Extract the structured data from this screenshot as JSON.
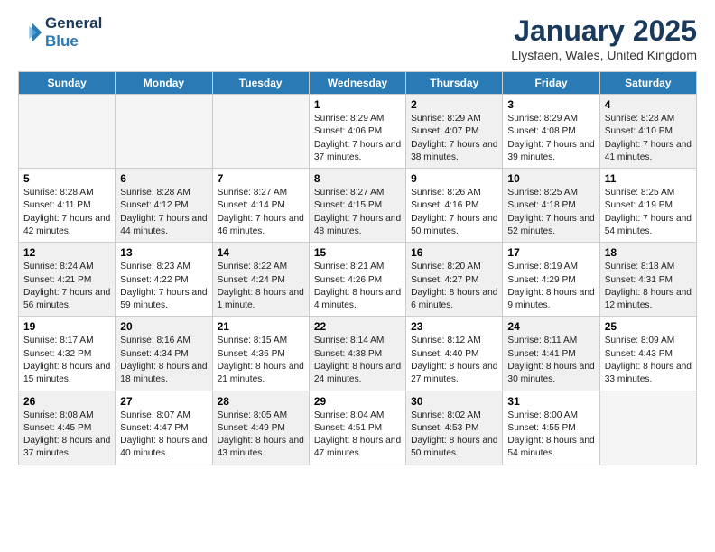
{
  "header": {
    "logo_line1": "General",
    "logo_line2": "Blue",
    "month": "January 2025",
    "location": "Llysfaen, Wales, United Kingdom"
  },
  "days_of_week": [
    "Sunday",
    "Monday",
    "Tuesday",
    "Wednesday",
    "Thursday",
    "Friday",
    "Saturday"
  ],
  "weeks": [
    [
      {
        "day": "",
        "content": "",
        "shaded": false,
        "empty": true
      },
      {
        "day": "",
        "content": "",
        "shaded": false,
        "empty": true
      },
      {
        "day": "",
        "content": "",
        "shaded": false,
        "empty": true
      },
      {
        "day": "1",
        "content": "Sunrise: 8:29 AM\nSunset: 4:06 PM\nDaylight: 7 hours and 37 minutes.",
        "shaded": false,
        "empty": false
      },
      {
        "day": "2",
        "content": "Sunrise: 8:29 AM\nSunset: 4:07 PM\nDaylight: 7 hours and 38 minutes.",
        "shaded": true,
        "empty": false
      },
      {
        "day": "3",
        "content": "Sunrise: 8:29 AM\nSunset: 4:08 PM\nDaylight: 7 hours and 39 minutes.",
        "shaded": false,
        "empty": false
      },
      {
        "day": "4",
        "content": "Sunrise: 8:28 AM\nSunset: 4:10 PM\nDaylight: 7 hours and 41 minutes.",
        "shaded": true,
        "empty": false
      }
    ],
    [
      {
        "day": "5",
        "content": "Sunrise: 8:28 AM\nSunset: 4:11 PM\nDaylight: 7 hours and 42 minutes.",
        "shaded": false,
        "empty": false
      },
      {
        "day": "6",
        "content": "Sunrise: 8:28 AM\nSunset: 4:12 PM\nDaylight: 7 hours and 44 minutes.",
        "shaded": true,
        "empty": false
      },
      {
        "day": "7",
        "content": "Sunrise: 8:27 AM\nSunset: 4:14 PM\nDaylight: 7 hours and 46 minutes.",
        "shaded": false,
        "empty": false
      },
      {
        "day": "8",
        "content": "Sunrise: 8:27 AM\nSunset: 4:15 PM\nDaylight: 7 hours and 48 minutes.",
        "shaded": true,
        "empty": false
      },
      {
        "day": "9",
        "content": "Sunrise: 8:26 AM\nSunset: 4:16 PM\nDaylight: 7 hours and 50 minutes.",
        "shaded": false,
        "empty": false
      },
      {
        "day": "10",
        "content": "Sunrise: 8:25 AM\nSunset: 4:18 PM\nDaylight: 7 hours and 52 minutes.",
        "shaded": true,
        "empty": false
      },
      {
        "day": "11",
        "content": "Sunrise: 8:25 AM\nSunset: 4:19 PM\nDaylight: 7 hours and 54 minutes.",
        "shaded": false,
        "empty": false
      }
    ],
    [
      {
        "day": "12",
        "content": "Sunrise: 8:24 AM\nSunset: 4:21 PM\nDaylight: 7 hours and 56 minutes.",
        "shaded": true,
        "empty": false
      },
      {
        "day": "13",
        "content": "Sunrise: 8:23 AM\nSunset: 4:22 PM\nDaylight: 7 hours and 59 minutes.",
        "shaded": false,
        "empty": false
      },
      {
        "day": "14",
        "content": "Sunrise: 8:22 AM\nSunset: 4:24 PM\nDaylight: 8 hours and 1 minute.",
        "shaded": true,
        "empty": false
      },
      {
        "day": "15",
        "content": "Sunrise: 8:21 AM\nSunset: 4:26 PM\nDaylight: 8 hours and 4 minutes.",
        "shaded": false,
        "empty": false
      },
      {
        "day": "16",
        "content": "Sunrise: 8:20 AM\nSunset: 4:27 PM\nDaylight: 8 hours and 6 minutes.",
        "shaded": true,
        "empty": false
      },
      {
        "day": "17",
        "content": "Sunrise: 8:19 AM\nSunset: 4:29 PM\nDaylight: 8 hours and 9 minutes.",
        "shaded": false,
        "empty": false
      },
      {
        "day": "18",
        "content": "Sunrise: 8:18 AM\nSunset: 4:31 PM\nDaylight: 8 hours and 12 minutes.",
        "shaded": true,
        "empty": false
      }
    ],
    [
      {
        "day": "19",
        "content": "Sunrise: 8:17 AM\nSunset: 4:32 PM\nDaylight: 8 hours and 15 minutes.",
        "shaded": false,
        "empty": false
      },
      {
        "day": "20",
        "content": "Sunrise: 8:16 AM\nSunset: 4:34 PM\nDaylight: 8 hours and 18 minutes.",
        "shaded": true,
        "empty": false
      },
      {
        "day": "21",
        "content": "Sunrise: 8:15 AM\nSunset: 4:36 PM\nDaylight: 8 hours and 21 minutes.",
        "shaded": false,
        "empty": false
      },
      {
        "day": "22",
        "content": "Sunrise: 8:14 AM\nSunset: 4:38 PM\nDaylight: 8 hours and 24 minutes.",
        "shaded": true,
        "empty": false
      },
      {
        "day": "23",
        "content": "Sunrise: 8:12 AM\nSunset: 4:40 PM\nDaylight: 8 hours and 27 minutes.",
        "shaded": false,
        "empty": false
      },
      {
        "day": "24",
        "content": "Sunrise: 8:11 AM\nSunset: 4:41 PM\nDaylight: 8 hours and 30 minutes.",
        "shaded": true,
        "empty": false
      },
      {
        "day": "25",
        "content": "Sunrise: 8:09 AM\nSunset: 4:43 PM\nDaylight: 8 hours and 33 minutes.",
        "shaded": false,
        "empty": false
      }
    ],
    [
      {
        "day": "26",
        "content": "Sunrise: 8:08 AM\nSunset: 4:45 PM\nDaylight: 8 hours and 37 minutes.",
        "shaded": true,
        "empty": false
      },
      {
        "day": "27",
        "content": "Sunrise: 8:07 AM\nSunset: 4:47 PM\nDaylight: 8 hours and 40 minutes.",
        "shaded": false,
        "empty": false
      },
      {
        "day": "28",
        "content": "Sunrise: 8:05 AM\nSunset: 4:49 PM\nDaylight: 8 hours and 43 minutes.",
        "shaded": true,
        "empty": false
      },
      {
        "day": "29",
        "content": "Sunrise: 8:04 AM\nSunset: 4:51 PM\nDaylight: 8 hours and 47 minutes.",
        "shaded": false,
        "empty": false
      },
      {
        "day": "30",
        "content": "Sunrise: 8:02 AM\nSunset: 4:53 PM\nDaylight: 8 hours and 50 minutes.",
        "shaded": true,
        "empty": false
      },
      {
        "day": "31",
        "content": "Sunrise: 8:00 AM\nSunset: 4:55 PM\nDaylight: 8 hours and 54 minutes.",
        "shaded": false,
        "empty": false
      },
      {
        "day": "",
        "content": "",
        "shaded": false,
        "empty": true
      }
    ]
  ]
}
